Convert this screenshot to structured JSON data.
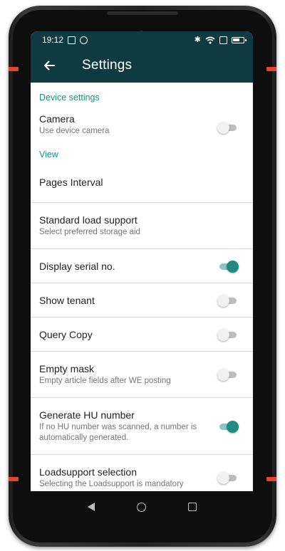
{
  "statusbar": {
    "time": "19:12"
  },
  "appbar": {
    "title": "Settings",
    "back_icon": "arrow-left-icon"
  },
  "sections": {
    "device": {
      "header": "Device settings"
    },
    "view": {
      "header": "View"
    }
  },
  "settings": {
    "camera": {
      "title": "Camera",
      "subtitle": "Use device camera",
      "enabled": false
    },
    "pages_interval": {
      "title": "Pages Interval"
    },
    "standard_load_support": {
      "title": "Standard load support",
      "subtitle": "Select preferred storage aid"
    },
    "display_serial": {
      "title": "Display serial no.",
      "enabled": true
    },
    "show_tenant": {
      "title": "Show tenant",
      "enabled": false
    },
    "query_copy": {
      "title": "Query Copy",
      "enabled": false
    },
    "empty_mask": {
      "title": "Empty mask",
      "subtitle": "Empty article fields after WE posting",
      "enabled": false
    },
    "generate_hu": {
      "title": "Generate HU number",
      "subtitle": "If no HU number was scanned, a number is automatically generated.",
      "enabled": true
    },
    "loadsupport_selection": {
      "title": "Loadsupport selection",
      "subtitle": "Selecting the Loadsupport is mandatory",
      "enabled": false
    }
  },
  "colors": {
    "accent": "#1f8c7f",
    "appbar": "#0f3a3f",
    "device_trim": "#e2462a"
  },
  "navbar": {
    "icons": [
      "nav-back-icon",
      "nav-home-icon",
      "nav-recents-icon"
    ]
  }
}
